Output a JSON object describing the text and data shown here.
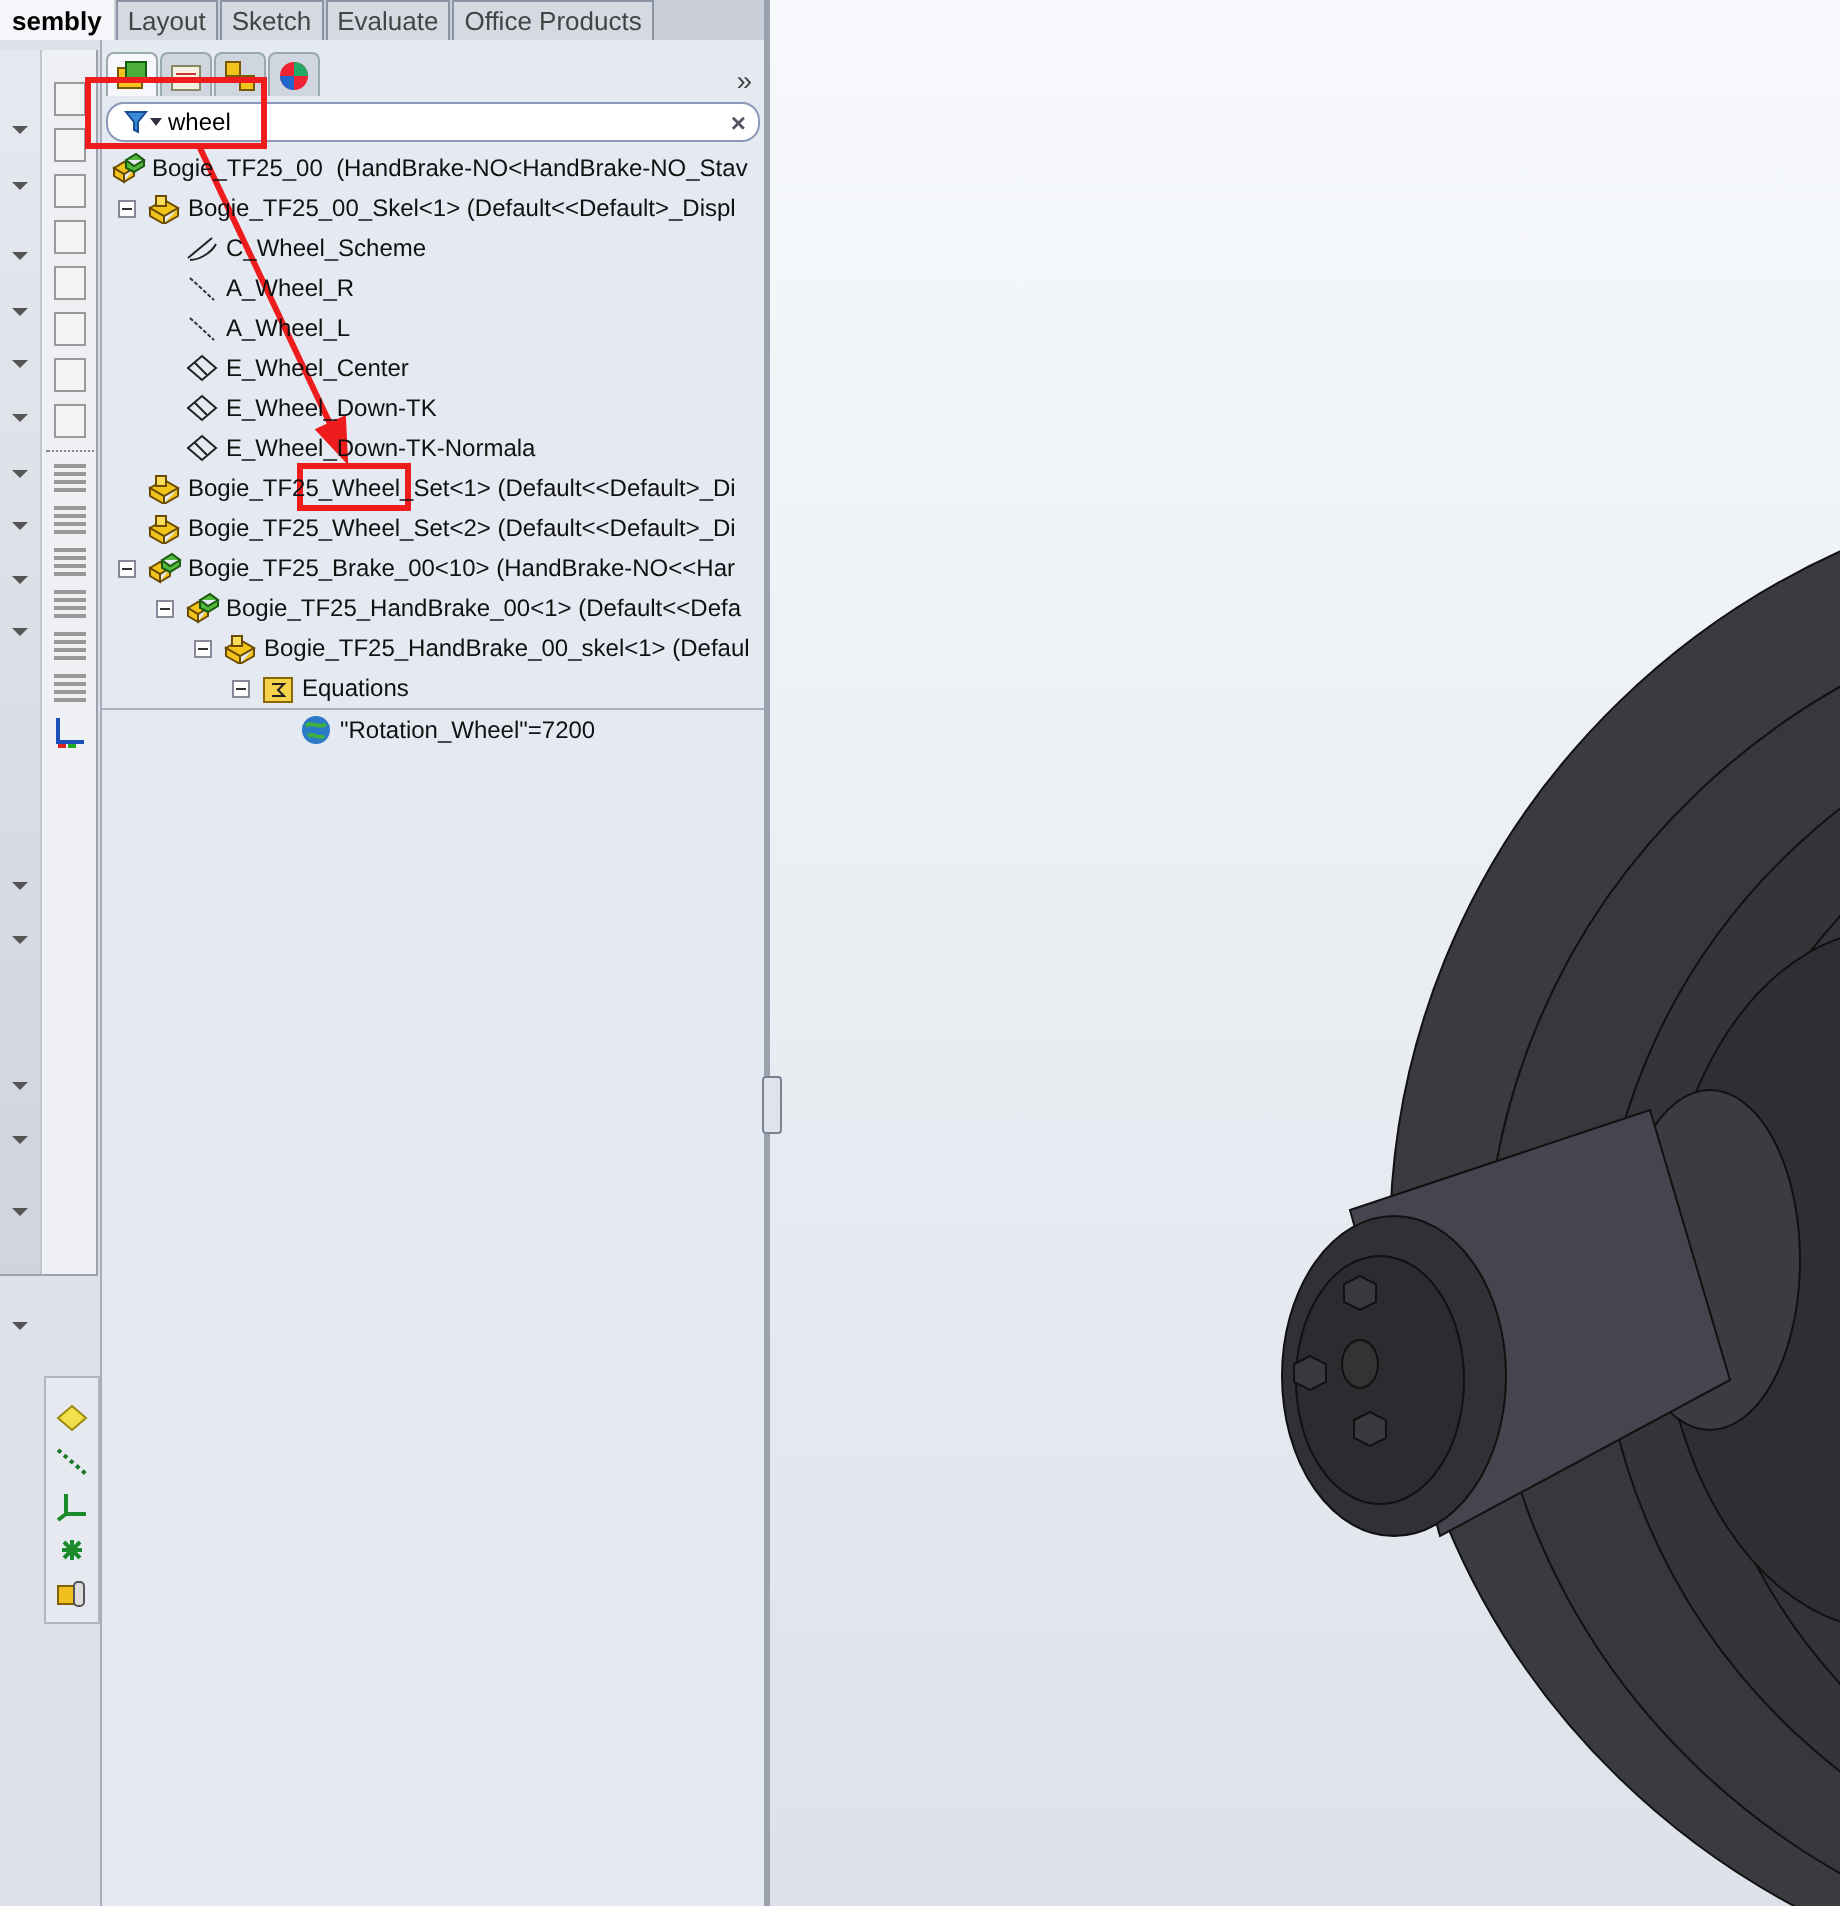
{
  "command_tabs": [
    {
      "label": "sembly",
      "selected": true
    },
    {
      "label": "Layout",
      "selected": false
    },
    {
      "label": "Sketch",
      "selected": false
    },
    {
      "label": "Evaluate",
      "selected": false
    },
    {
      "label": "Office Products",
      "selected": false
    }
  ],
  "panel": {
    "tabs": [
      {
        "kind": "feature-tree",
        "selected": true
      },
      {
        "kind": "properties",
        "selected": false
      },
      {
        "kind": "configurations",
        "selected": false
      },
      {
        "kind": "display",
        "selected": false
      }
    ],
    "expand_button": "»",
    "search": {
      "value": "wheel",
      "clear": "×"
    },
    "tree": [
      {
        "kind": "assembly",
        "label": "Bogie_TF25_00  (HandBrake-NO<HandBrake-NO_Stav",
        "children": [
          {
            "kind": "part",
            "label": "Bogie_TF25_00_Skel<1> (Default<<Default>_Displ",
            "expanded": true,
            "children": [
              {
                "kind": "sketch",
                "label": "C_Wheel_Scheme"
              },
              {
                "kind": "axis",
                "label": "A_Wheel_R"
              },
              {
                "kind": "axis",
                "label": "A_Wheel_L"
              },
              {
                "kind": "plane",
                "label": "E_Wheel_Center"
              },
              {
                "kind": "plane",
                "label": "E_Wheel_Down-TK"
              },
              {
                "kind": "plane",
                "label": "E_Wheel_Down-TK-Normala"
              }
            ]
          },
          {
            "kind": "part",
            "label": "Bogie_TF25_Wheel_Set<1> (Default<<Default>_Di"
          },
          {
            "kind": "part",
            "label": "Bogie_TF25_Wheel_Set<2> (Default<<Default>_Di"
          },
          {
            "kind": "assembly",
            "label": "Bogie_TF25_Brake_00<10> (HandBrake-NO<<Har",
            "expanded": true,
            "children": [
              {
                "kind": "assembly",
                "label": "Bogie_TF25_HandBrake_00<1> (Default<<Defa",
                "expanded": true,
                "children": [
                  {
                    "kind": "part",
                    "label": "Bogie_TF25_HandBrake_00_skel<1> (Defaul",
                    "expanded": true,
                    "children": [
                      {
                        "kind": "folder",
                        "label": "Equations",
                        "expanded": true,
                        "children": [
                          {
                            "kind": "equation",
                            "label": "\"Rotation_Wheel\"=7200"
                          }
                        ]
                      }
                    ]
                  }
                ]
              }
            ]
          }
        ]
      }
    ]
  }
}
